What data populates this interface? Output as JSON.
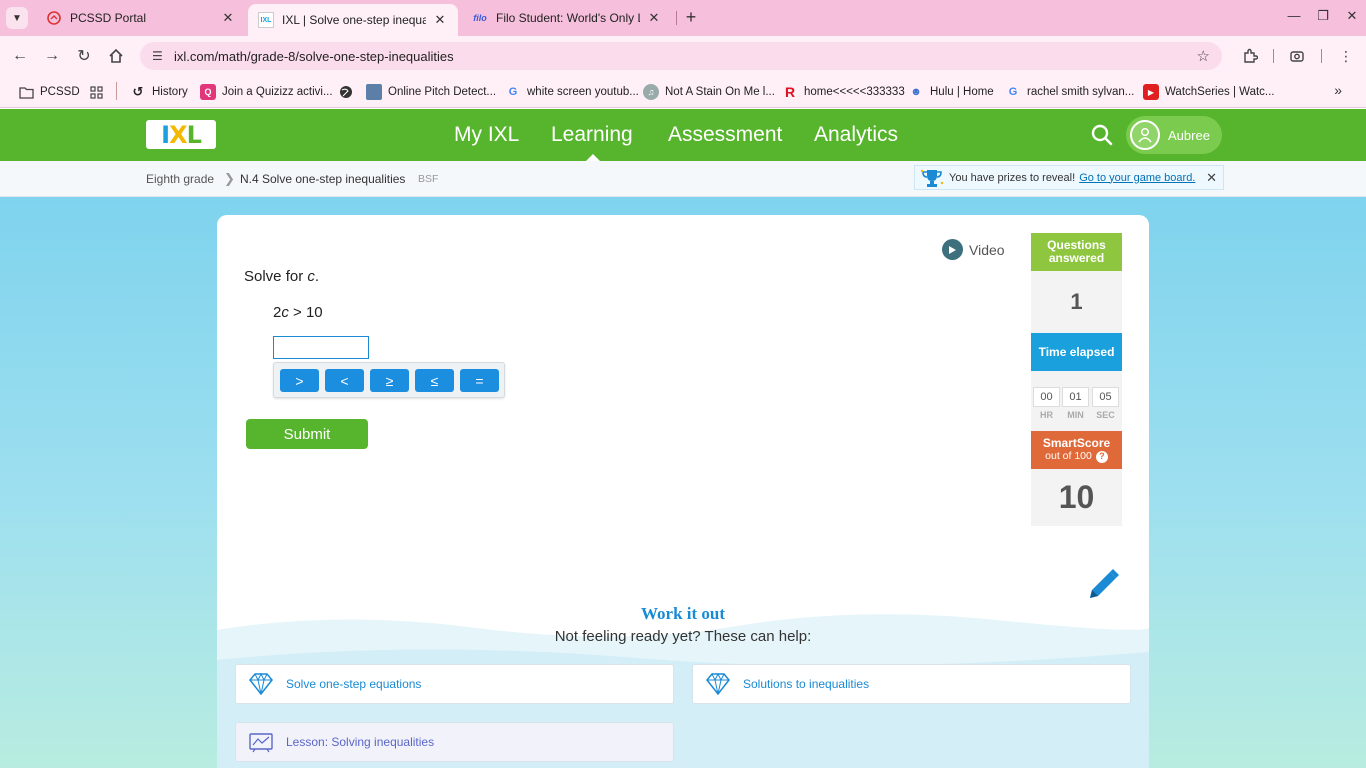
{
  "browser": {
    "tabs": [
      {
        "title": "PCSSD Portal",
        "active": false
      },
      {
        "title": "IXL | Solve one-step inequalities",
        "active": true
      },
      {
        "title": "Filo Student: World's Only Live",
        "active": false
      }
    ],
    "favicon_filo": "filo",
    "favicon_ixl": "IXL",
    "new_tab": "+",
    "url": "ixl.com/math/grade-8/solve-one-step-inequalities",
    "bookmarks": [
      {
        "label": "PCSSD",
        "icon": "folder-icon"
      },
      {
        "label": "",
        "icon": "apps-grid-icon"
      },
      {
        "label": "History",
        "icon": "history-icon"
      },
      {
        "label": "Join a Quizizz activi...",
        "icon": "quizizz-icon"
      },
      {
        "label": "",
        "icon": "globe-icon"
      },
      {
        "label": "Online Pitch Detect...",
        "icon": "pitch-icon"
      },
      {
        "label": "white screen youtub...",
        "icon": "google-icon"
      },
      {
        "label": "Not A Stain On Me l...",
        "icon": "music-icon"
      },
      {
        "label": "home<<<<<333333",
        "icon": "r-icon"
      },
      {
        "label": "Hulu | Home",
        "icon": "people-icon"
      },
      {
        "label": "rachel smith sylvan...",
        "icon": "google-icon"
      },
      {
        "label": "WatchSeries | Watc...",
        "icon": "play-icon"
      }
    ],
    "bookmark_glyphs": {
      "google": "G",
      "r": "R"
    }
  },
  "ixl": {
    "logo": {
      "a": "I",
      "b": "X",
      "c": "L"
    },
    "nav": [
      "My IXL",
      "Learning",
      "Assessment",
      "Analytics"
    ],
    "active_nav": "Learning",
    "user_name": "Aubree",
    "breadcrumb": {
      "grade": "Eighth grade",
      "skill": "N.4 Solve one-step inequalities",
      "code": "BSF"
    },
    "prize": {
      "text": "You have prizes to reveal!",
      "link": "Go to your game board."
    }
  },
  "question": {
    "video_label": "Video",
    "prompt_prefix": "Solve for ",
    "prompt_var": "c",
    "prompt_suffix": ".",
    "equation": {
      "coef": "2",
      "var": "c",
      "rest": " > 10"
    },
    "answer_value": "",
    "symbols": [
      ">",
      "<",
      "≥",
      "≤",
      "="
    ],
    "submit_label": "Submit"
  },
  "stats": {
    "questions_label": "Questions answered",
    "questions_value": "1",
    "time_label": "Time elapsed",
    "time": {
      "hr": "00",
      "min": "01",
      "sec": "05"
    },
    "time_units": {
      "hr": "HR",
      "min": "MIN",
      "sec": "SEC"
    },
    "smartscore_label": "SmartScore",
    "smartscore_sub": "out of 100",
    "help_mark": "?",
    "smartscore_value": "10",
    "colors": {
      "questions": "#8ec640",
      "time": "#1aa0dc",
      "smartscore": "#e0693a"
    }
  },
  "work_it_out": {
    "title": "Work it out",
    "subtitle": "Not feeling ready yet? These can help:",
    "links": [
      {
        "label": "Solve one-step equations",
        "icon": "diamond-icon"
      },
      {
        "label": "Solutions to inequalities",
        "icon": "diamond-icon"
      },
      {
        "label": "Lesson: Solving inequalities",
        "icon": "lesson-icon"
      }
    ]
  }
}
